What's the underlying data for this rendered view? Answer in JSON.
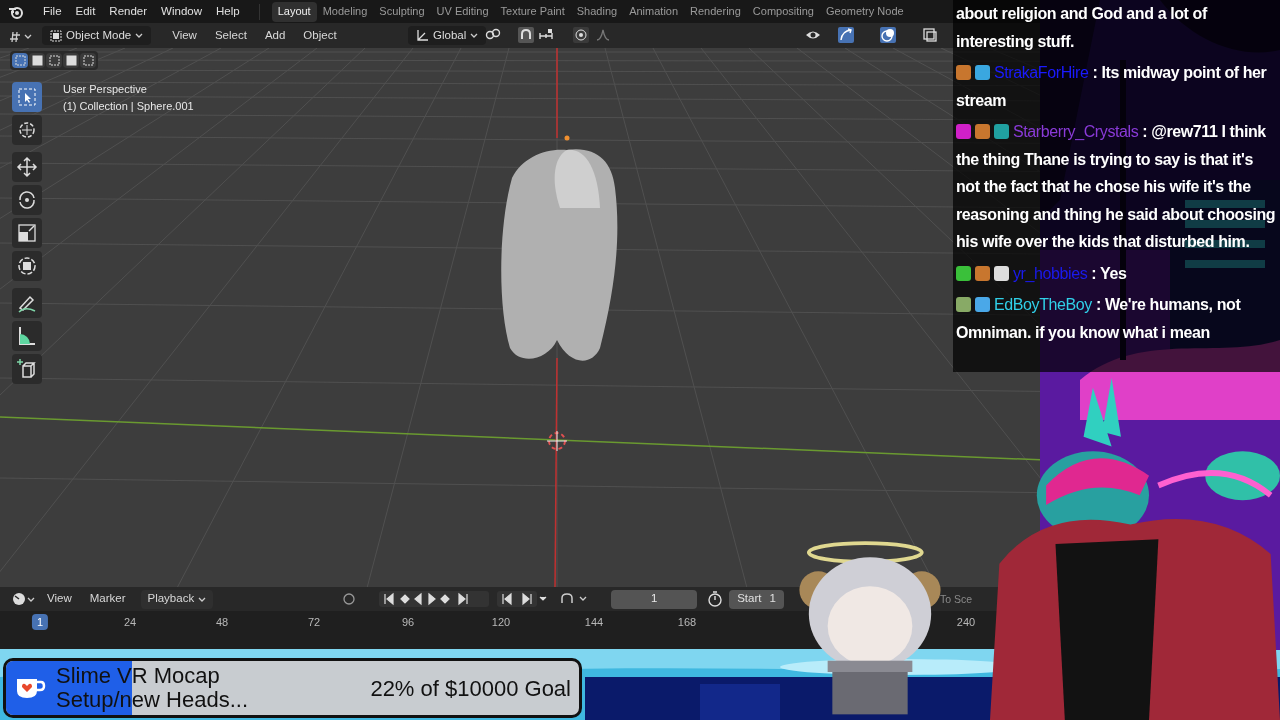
{
  "menu": [
    "File",
    "Edit",
    "Render",
    "Window",
    "Help"
  ],
  "workspaces": [
    {
      "label": "Layout",
      "selected": true
    },
    {
      "label": "Modeling",
      "selected": false
    },
    {
      "label": "Sculpting",
      "selected": false
    },
    {
      "label": "UV Editing",
      "selected": false
    },
    {
      "label": "Texture Paint",
      "selected": false
    },
    {
      "label": "Shading",
      "selected": false
    },
    {
      "label": "Animation",
      "selected": false
    },
    {
      "label": "Rendering",
      "selected": false
    },
    {
      "label": "Compositing",
      "selected": false
    },
    {
      "label": "Geometry Node",
      "selected": false
    }
  ],
  "viewport_header": {
    "mode": "Object Mode",
    "menus": [
      "View",
      "Select",
      "Add",
      "Object"
    ],
    "orientation": "Global"
  },
  "select_modes": [
    {
      "selected": true
    },
    {
      "selected": false
    },
    {
      "selected": false
    },
    {
      "selected": false
    },
    {
      "selected": false
    }
  ],
  "viewport": {
    "view_name": "User Perspective",
    "collection": "(1) Collection | Sphere.001"
  },
  "tools": [
    {
      "kind": "select",
      "selected": true
    },
    {
      "kind": "cursor",
      "selected": false
    },
    {
      "kind": "move",
      "selected": false
    },
    {
      "kind": "rotate",
      "selected": false
    },
    {
      "kind": "scale",
      "selected": false
    },
    {
      "kind": "transform",
      "selected": false
    },
    {
      "kind": "annotate",
      "selected": false
    },
    {
      "kind": "measure",
      "selected": false
    },
    {
      "kind": "add-cube",
      "selected": false
    }
  ],
  "timeline": {
    "menus": [
      "View",
      "Marker",
      "Playback"
    ],
    "current_frame": "1",
    "start_label": "Start",
    "start_value": "1",
    "partial_label": "To Sce",
    "ruler": [
      {
        "label": "1",
        "selected": true
      },
      {
        "label": "24",
        "selected": false
      },
      {
        "label": "48",
        "selected": false
      },
      {
        "label": "72",
        "selected": false
      },
      {
        "label": "96",
        "selected": false
      },
      {
        "label": "120",
        "selected": false
      },
      {
        "label": "144",
        "selected": false
      },
      {
        "label": "168",
        "selected": false
      },
      {
        "label": "240",
        "selected": false
      }
    ]
  },
  "chat": [
    {
      "kind": "continuation",
      "text": "about religion and God and a lot of interesting stuff."
    },
    {
      "kind": "message",
      "badges": [
        {
          "color": "#c8762e"
        },
        {
          "color": "#3aa7e0"
        }
      ],
      "user": "StrakaForHire",
      "color": "#1a1aff",
      "text": ": Its midway point of her stream"
    },
    {
      "kind": "message",
      "badges": [
        {
          "color": "#d020c8"
        },
        {
          "color": "#c8762e"
        },
        {
          "color": "#20a0a0"
        }
      ],
      "user": "Starberry_Crystals",
      "color": "#8a3ad8",
      "text": ": @rew711 I think the thing Thane is trying to say is that it's not the fact that he chose his wife it's the reasoning and thing he said about choosing his wife over the kids that disturbed him."
    },
    {
      "kind": "message",
      "badges": [
        {
          "color": "#3ac03a"
        },
        {
          "color": "#c8762e"
        },
        {
          "color": "#dddddd"
        }
      ],
      "user": "yr_hobbies",
      "color": "#1a1aee",
      "text": ": Yes"
    },
    {
      "kind": "message",
      "badges": [
        {
          "color": "#88aa66"
        },
        {
          "color": "#4aa8e8"
        }
      ],
      "user": "EdBoyTheBoy",
      "color": "#30d0e8",
      "text": ": We're humans, not Omniman. if you know what i mean"
    }
  ],
  "goal": {
    "title": "Slime VR Mocap Setup/new Heads...",
    "progress": "22% of $10000 Goal",
    "level": 0.22
  }
}
